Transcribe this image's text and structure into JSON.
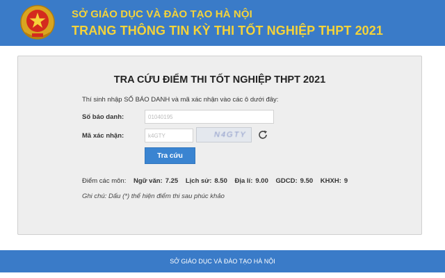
{
  "header": {
    "org_name": "SỞ GIÁO DỤC VÀ ĐÀO TẠO HÀ NỘI",
    "site_title": "TRANG THÔNG TIN KỲ THI TỐT NGHIỆP THPT 2021",
    "emblem_icon": "national-emblem-icon"
  },
  "form": {
    "title": "TRA CỨU ĐIỂM THI TỐT NGHIỆP THPT 2021",
    "instruction": "Thí sinh nhập SỐ BÁO DANH và mã xác nhận vào các ô dưới đây:",
    "sbd_label": "Số báo danh:",
    "sbd_value": "01040195",
    "captcha_label": "Mã xác nhận:",
    "captcha_value": "k4GTY",
    "captcha_text": "N4GTY",
    "refresh_icon": "refresh-icon",
    "submit_label": "Tra cứu"
  },
  "result": {
    "label": "Điểm các môn:",
    "subjects": [
      {
        "name": "Ngữ văn:",
        "score": "7.25"
      },
      {
        "name": "Lịch sử:",
        "score": "8.50"
      },
      {
        "name": "Địa lí:",
        "score": "9.00"
      },
      {
        "name": "GDCD:",
        "score": "9.50"
      },
      {
        "name": "KHXH:",
        "score": "9"
      }
    ],
    "note": "Ghi chú: Dấu (*) thể hiện điểm thi sau phúc khảo"
  },
  "footer": {
    "text": "SỞ GIÁO DỤC VÀ ĐÀO TẠO HÀ NỘI"
  },
  "colors": {
    "header_bg": "#3a7bc8",
    "title_yellow": "#f4d33a",
    "button_blue": "#3a84d1",
    "panel_bg": "#eeeeee"
  }
}
